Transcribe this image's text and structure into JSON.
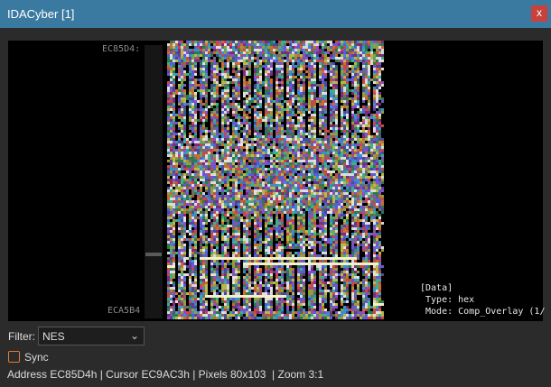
{
  "window": {
    "title": "IDACyber [1]",
    "close_glyph": "x"
  },
  "viewer": {
    "addr_start": "EC85D4:",
    "addr_end": "ECA5B4",
    "info_lines": [
      "[Data]",
      " Type: hex",
      " Mode: Comp_Overlay (1/"
    ],
    "palette": [
      "#5b5bd6",
      "#8a4fc4",
      "#3fae8a",
      "#c44a4a",
      "#d8d8d8",
      "#6e6e6e",
      "#b8b84a",
      "#3a8fc8",
      "#c86e2e",
      "#9a9a3a",
      "#4a4a9a",
      "#e0e0e0",
      "#7a2e7a",
      "#2e7a4a"
    ],
    "highlight_color": "#f2f2c8",
    "background_color": "#000000"
  },
  "filter": {
    "label": "Filter:",
    "value": "NES"
  },
  "sync": {
    "label": "Sync",
    "checked": false,
    "accent": "#e07b39"
  },
  "status": "Address EC85D4h | Cursor EC9AC3h | Pixels 80x103  | Zoom 3:1"
}
